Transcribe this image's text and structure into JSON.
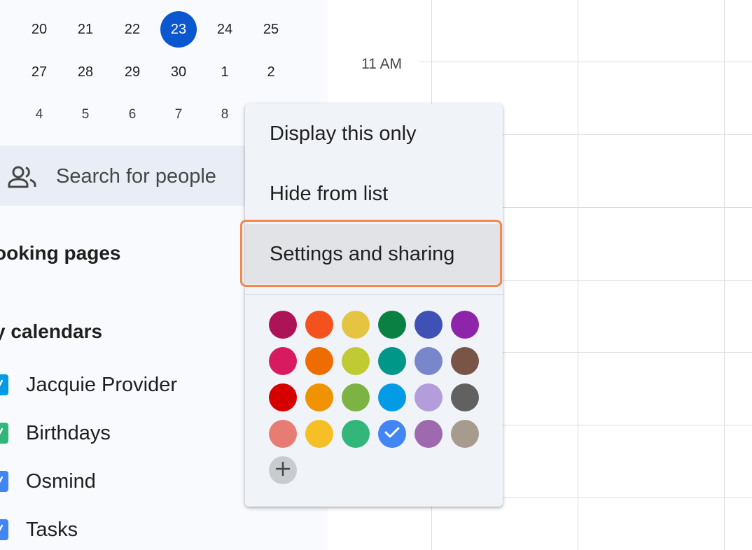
{
  "mini_calendar": {
    "rows": [
      {
        "days": [
          "20",
          "21",
          "22",
          "23",
          "24",
          "25"
        ],
        "today_index": 3
      },
      {
        "days": [
          "27",
          "28",
          "29",
          "30",
          "1",
          "2"
        ],
        "today_index": -1
      },
      {
        "days": [
          "4",
          "5",
          "6",
          "7",
          "8"
        ],
        "today_index": -1
      }
    ],
    "today_color": "#0b57d0"
  },
  "search_people": {
    "label": "Search for people",
    "icon": "people-icon"
  },
  "booking_pages": {
    "title": "ooking pages"
  },
  "my_calendars": {
    "title": "y calendars",
    "items": [
      {
        "label": "Jacquie Provider",
        "color": "#039be5"
      },
      {
        "label": "Birthdays",
        "color": "#33b679"
      },
      {
        "label": "Osmind",
        "color": "#4285f4"
      },
      {
        "label": "Tasks",
        "color": "#4285f4"
      }
    ]
  },
  "grid": {
    "time_label": "11 AM"
  },
  "context_menu": {
    "items": [
      {
        "label": "Display this only"
      },
      {
        "label": "Hide from list"
      },
      {
        "label": "Settings and sharing",
        "highlighted": true
      }
    ],
    "colors": [
      [
        "#ad1457",
        "#f4511e",
        "#e4c441",
        "#0b8043",
        "#3f51b5",
        "#8e24aa"
      ],
      [
        "#d81b60",
        "#ef6c00",
        "#c0ca33",
        "#009688",
        "#7986cb",
        "#795548"
      ],
      [
        "#d50000",
        "#f09300",
        "#7cb342",
        "#039be5",
        "#b39ddb",
        "#616161"
      ],
      [
        "#e67c73",
        "#f6bf26",
        "#33b679",
        "#4285f4",
        "#9e69af",
        "#a79b8e"
      ]
    ],
    "selected_color": "#4285f4",
    "add_color_icon": "plus-icon"
  }
}
